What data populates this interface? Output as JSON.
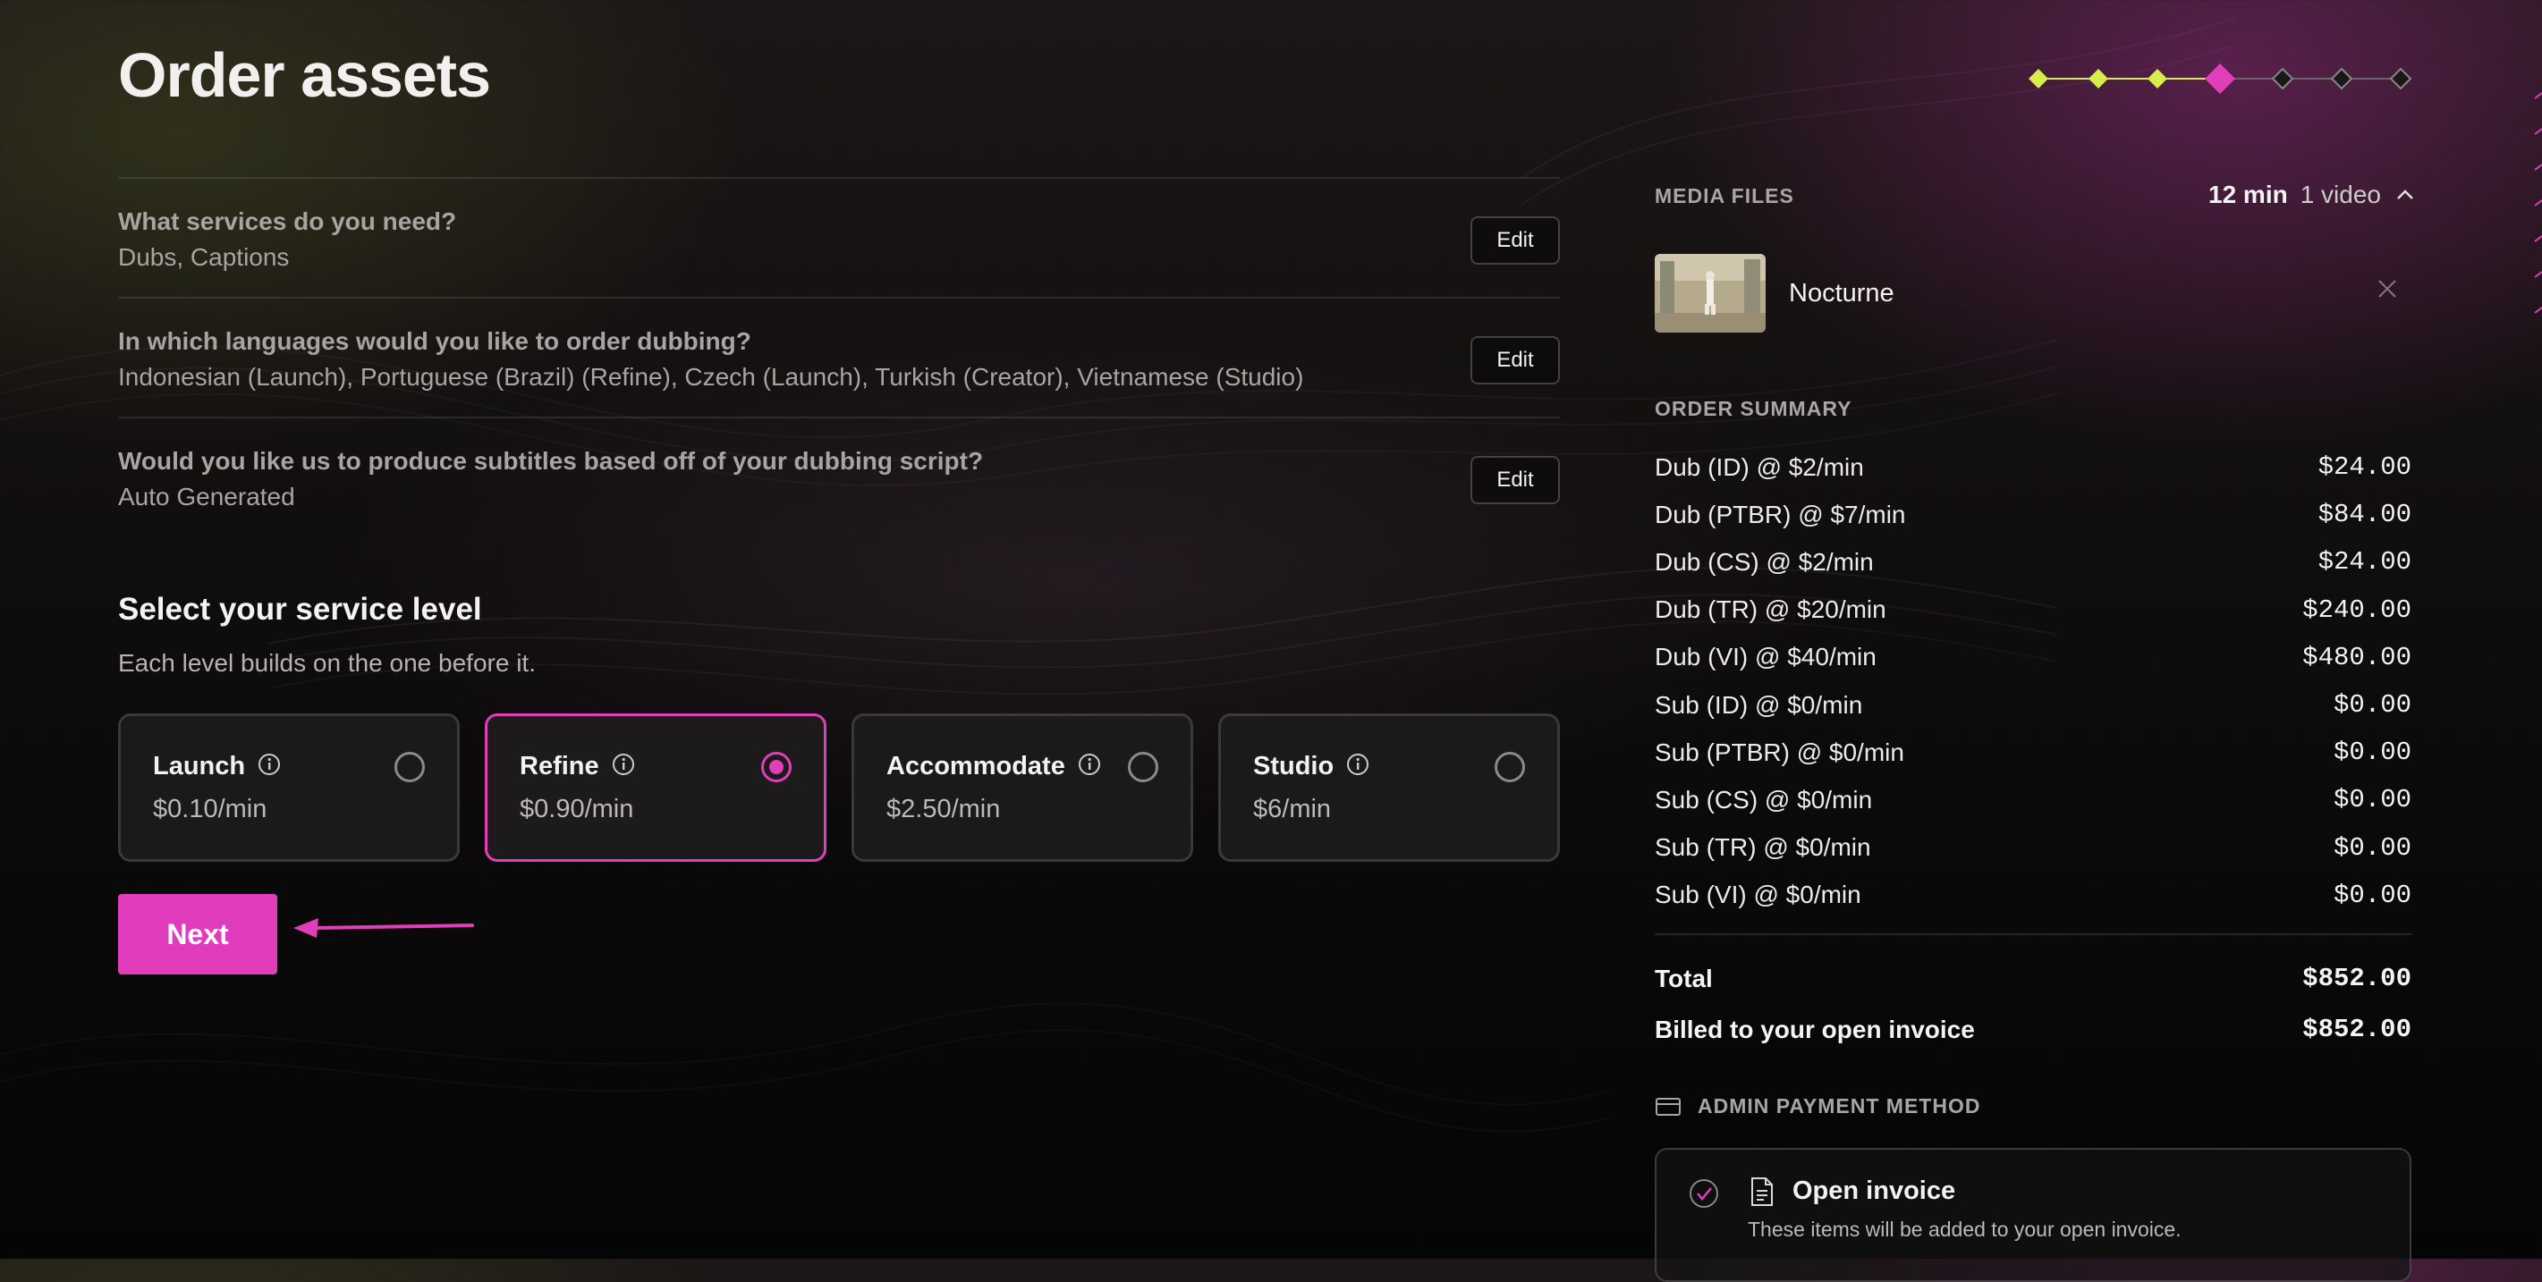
{
  "page": {
    "title": "Order assets"
  },
  "stepper": {
    "total_steps": 7,
    "current_step": 4,
    "completed_color": "#d8ec4a",
    "current_color": "#e13fb9"
  },
  "questions": [
    {
      "question": "What services do you need?",
      "answer": "Dubs, Captions",
      "edit_label": "Edit"
    },
    {
      "question": "In which languages would you like to order dubbing?",
      "answer": "Indonesian (Launch), Portuguese (Brazil) (Refine), Czech (Launch), Turkish (Creator), Vietnamese (Studio)",
      "edit_label": "Edit"
    },
    {
      "question": "Would you like us to produce subtitles based off of your dubbing script?",
      "answer": "Auto Generated",
      "edit_label": "Edit"
    }
  ],
  "service_level": {
    "title": "Select your service level",
    "subtitle": "Each level builds on the one before it.",
    "options": [
      {
        "name": "Launch",
        "price": "$0.10/min",
        "selected": false
      },
      {
        "name": "Refine",
        "price": "$0.90/min",
        "selected": true
      },
      {
        "name": "Accommodate",
        "price": "$2.50/min",
        "selected": false
      },
      {
        "name": "Studio",
        "price": "$6/min",
        "selected": false
      }
    ]
  },
  "next_label": "Next",
  "media_files": {
    "label": "MEDIA FILES",
    "duration": "12 min",
    "count": "1 video",
    "files": [
      {
        "name": "Nocturne"
      }
    ]
  },
  "order_summary": {
    "label": "ORDER SUMMARY",
    "items": [
      {
        "label": "Dub (ID) @ $2/min",
        "amount": "$24.00"
      },
      {
        "label": "Dub (PTBR) @ $7/min",
        "amount": "$84.00"
      },
      {
        "label": "Dub (CS) @ $2/min",
        "amount": "$24.00"
      },
      {
        "label": "Dub (TR) @ $20/min",
        "amount": "$240.00"
      },
      {
        "label": "Dub (VI) @ $40/min",
        "amount": "$480.00"
      },
      {
        "label": "Sub (ID) @ $0/min",
        "amount": "$0.00"
      },
      {
        "label": "Sub (PTBR) @ $0/min",
        "amount": "$0.00"
      },
      {
        "label": "Sub (CS) @ $0/min",
        "amount": "$0.00"
      },
      {
        "label": "Sub (TR) @ $0/min",
        "amount": "$0.00"
      },
      {
        "label": "Sub (VI) @ $0/min",
        "amount": "$0.00"
      }
    ],
    "total_label": "Total",
    "total": "$852.00",
    "billed_label": "Billed to your open invoice",
    "billed": "$852.00"
  },
  "payment": {
    "label": "ADMIN PAYMENT METHOD",
    "option_title": "Open invoice",
    "option_desc": "These items will be added to your open invoice."
  },
  "colors": {
    "accent": "#e13fb9",
    "lime": "#d8ec4a"
  }
}
